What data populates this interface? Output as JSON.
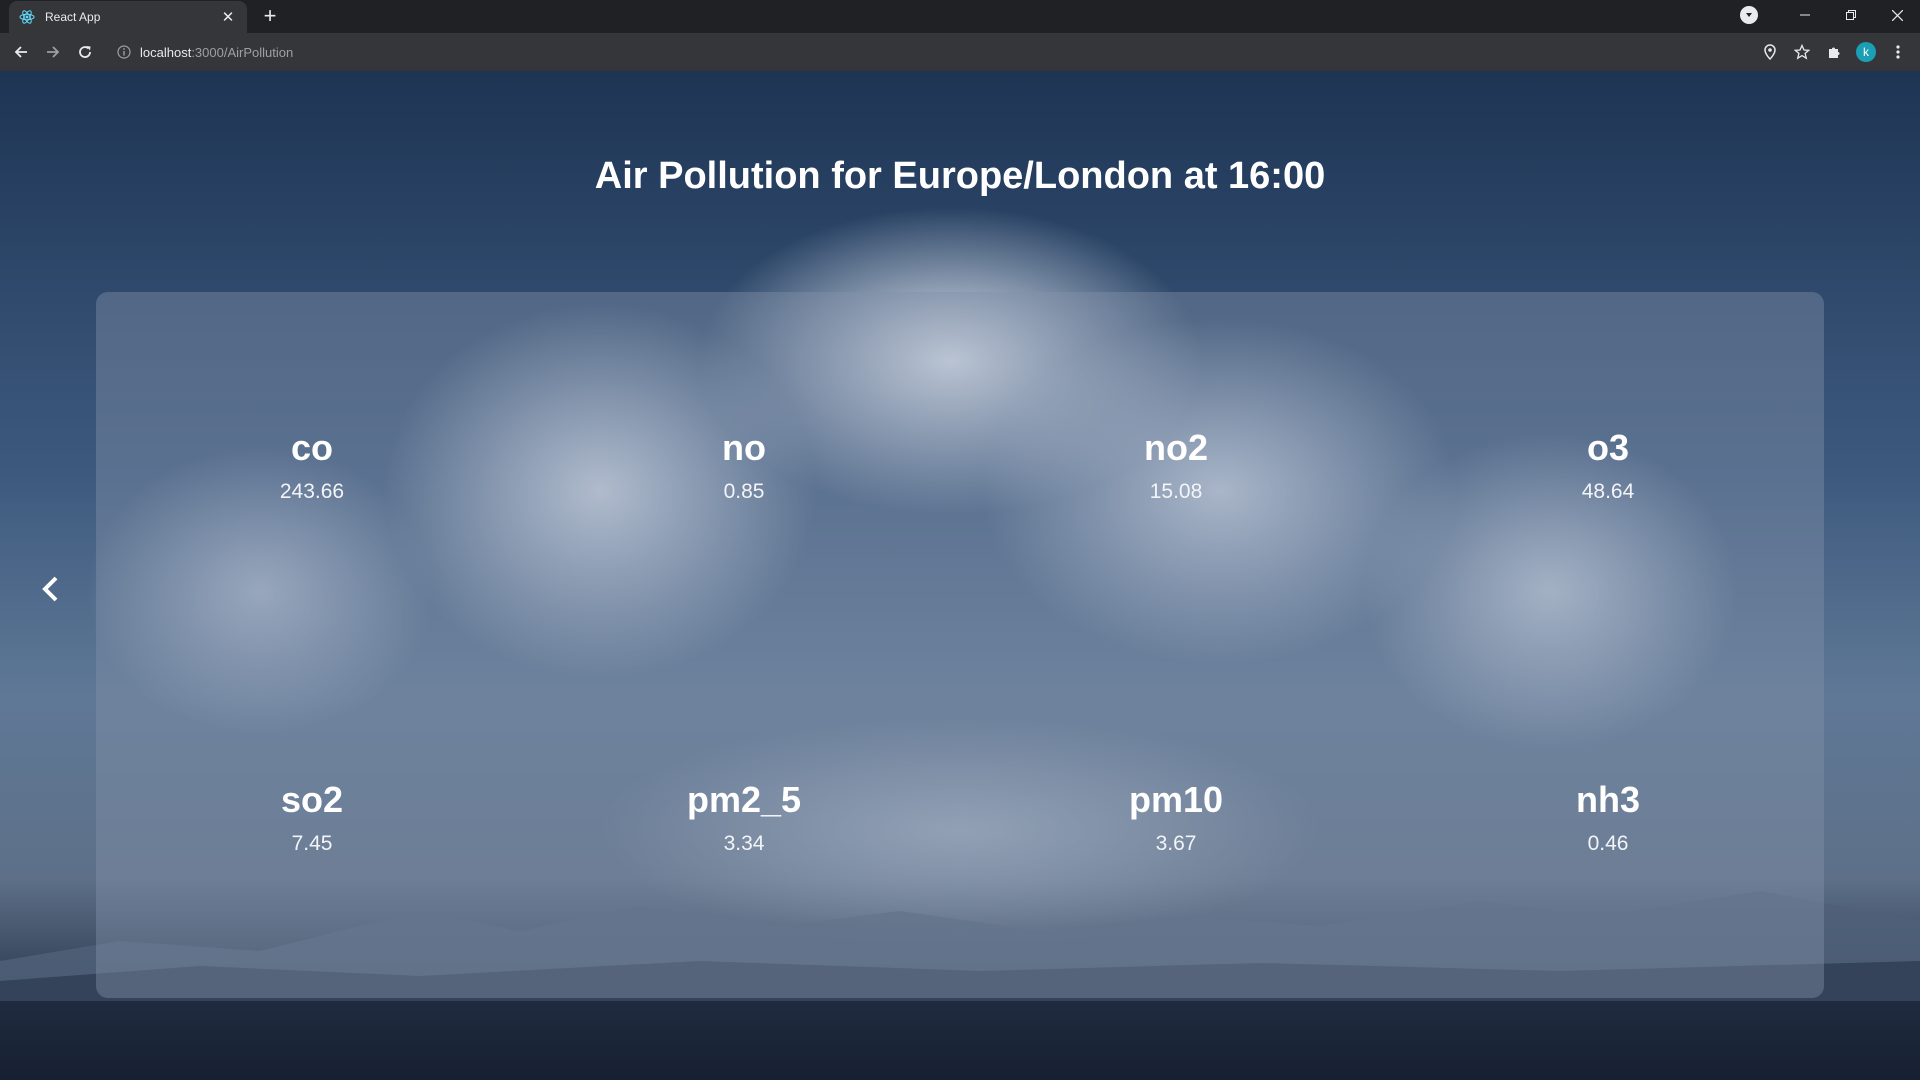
{
  "browser": {
    "tab_title": "React App",
    "url_host": "localhost",
    "url_path": ":3000/AirPollution",
    "profile_initial": "k"
  },
  "icons": {
    "tab_favicon": "react-logo-icon",
    "tab_close": "close-icon",
    "new_tab": "plus-icon",
    "back": "arrow-left-icon",
    "forward": "arrow-right-icon",
    "reload": "reload-icon",
    "site_info": "info-icon",
    "location": "location-pin-icon",
    "bookmark": "star-icon",
    "extensions": "puzzle-icon",
    "menu": "kebab-menu-icon",
    "carousel_prev": "chevron-left-icon"
  },
  "page": {
    "title": "Air Pollution for Europe/London at 16:00",
    "metrics": [
      {
        "name": "co",
        "value": "243.66"
      },
      {
        "name": "no",
        "value": "0.85"
      },
      {
        "name": "no2",
        "value": "15.08"
      },
      {
        "name": "o3",
        "value": "48.64"
      },
      {
        "name": "so2",
        "value": "7.45"
      },
      {
        "name": "pm2_5",
        "value": "3.34"
      },
      {
        "name": "pm10",
        "value": "3.67"
      },
      {
        "name": "nh3",
        "value": "0.46"
      }
    ]
  },
  "colors": {
    "chrome_dark": "#202124",
    "chrome_toolbar": "#35363a",
    "avatar": "#1a9fb5",
    "text": "#ffffff"
  }
}
